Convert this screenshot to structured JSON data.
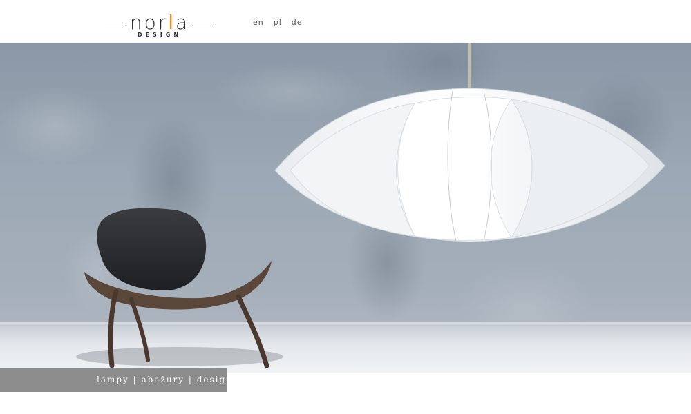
{
  "header": {
    "logo": {
      "wordmark_start": "nor",
      "wordmark_accent": "l",
      "wordmark_end": "a",
      "subtitle": "DESIGN",
      "accent_color": "#e8931e"
    },
    "languages": [
      "en",
      "pl",
      "de"
    ]
  },
  "hero": {
    "caption": "lampy | abażury | design",
    "caption_bar_color": "#8c8c8c"
  }
}
